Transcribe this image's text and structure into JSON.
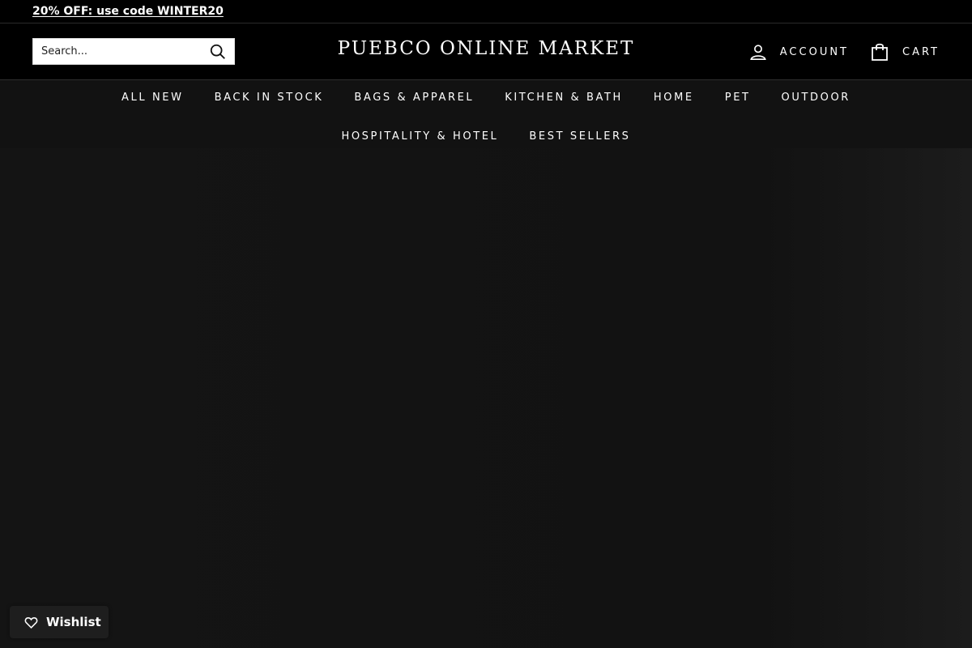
{
  "announcement": {
    "text": "20% OFF: use code WINTER20"
  },
  "header": {
    "logo": "PUEBCO ONLINE MARKET",
    "search": {
      "placeholder": "Search...",
      "icon": "search-icon"
    },
    "account": {
      "label": "ACCOUNT",
      "icon": "user-icon"
    },
    "cart": {
      "label": "CART",
      "icon": "shopping-bag-icon"
    }
  },
  "nav": {
    "row1": [
      "ALL NEW",
      "BACK IN STOCK",
      "BAGS & APPAREL",
      "KITCHEN & BATH",
      "HOME",
      "PET",
      "OUTDOOR"
    ],
    "row2": [
      "HOSPITALITY & HOTEL",
      "BEST SELLERS"
    ]
  },
  "wishlist": {
    "label": "Wishlist",
    "icon": "heart-icon"
  },
  "colors": {
    "background": "#121212",
    "header_bg": "#000000",
    "text": "#ffffff"
  }
}
